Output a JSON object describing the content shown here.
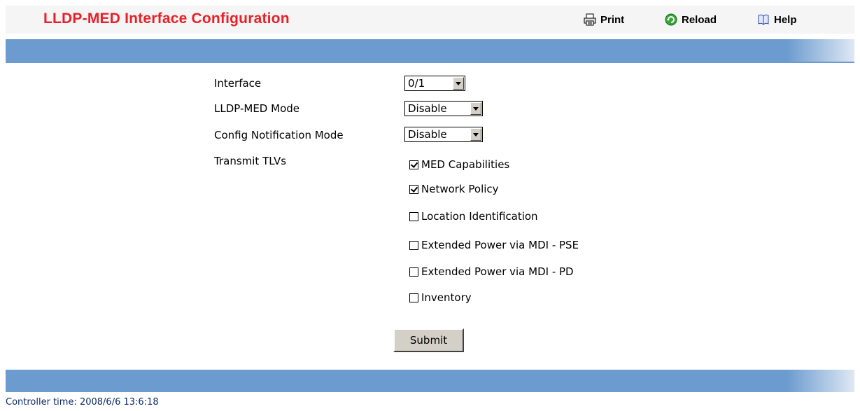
{
  "header": {
    "title": "LLDP-MED Interface Configuration",
    "print_label": "Print",
    "reload_label": "Reload",
    "help_label": "Help"
  },
  "colors": {
    "title": "#e8202a",
    "band": "#6b9bcf",
    "header_bg": "#f5f5f5"
  },
  "form": {
    "interface": {
      "label": "Interface",
      "value": "0/1"
    },
    "lldp_med_mode": {
      "label": "LLDP-MED Mode",
      "value": "Disable"
    },
    "config_notification_mode": {
      "label": "Config Notification Mode",
      "value": "Disable"
    },
    "transmit_tlvs": {
      "label": "Transmit TLVs",
      "options": [
        {
          "label": "MED Capabilities",
          "checked": true
        },
        {
          "label": "Network Policy",
          "checked": true
        },
        {
          "label": "Location Identification",
          "checked": false
        },
        {
          "label": "Extended Power via MDI - PSE",
          "checked": false
        },
        {
          "label": "Extended Power via MDI - PD",
          "checked": false
        },
        {
          "label": "Inventory",
          "checked": false
        }
      ]
    },
    "submit_label": "Submit"
  },
  "footer": {
    "controller_time": "Controller time: 2008/6/6 13:6:18"
  }
}
